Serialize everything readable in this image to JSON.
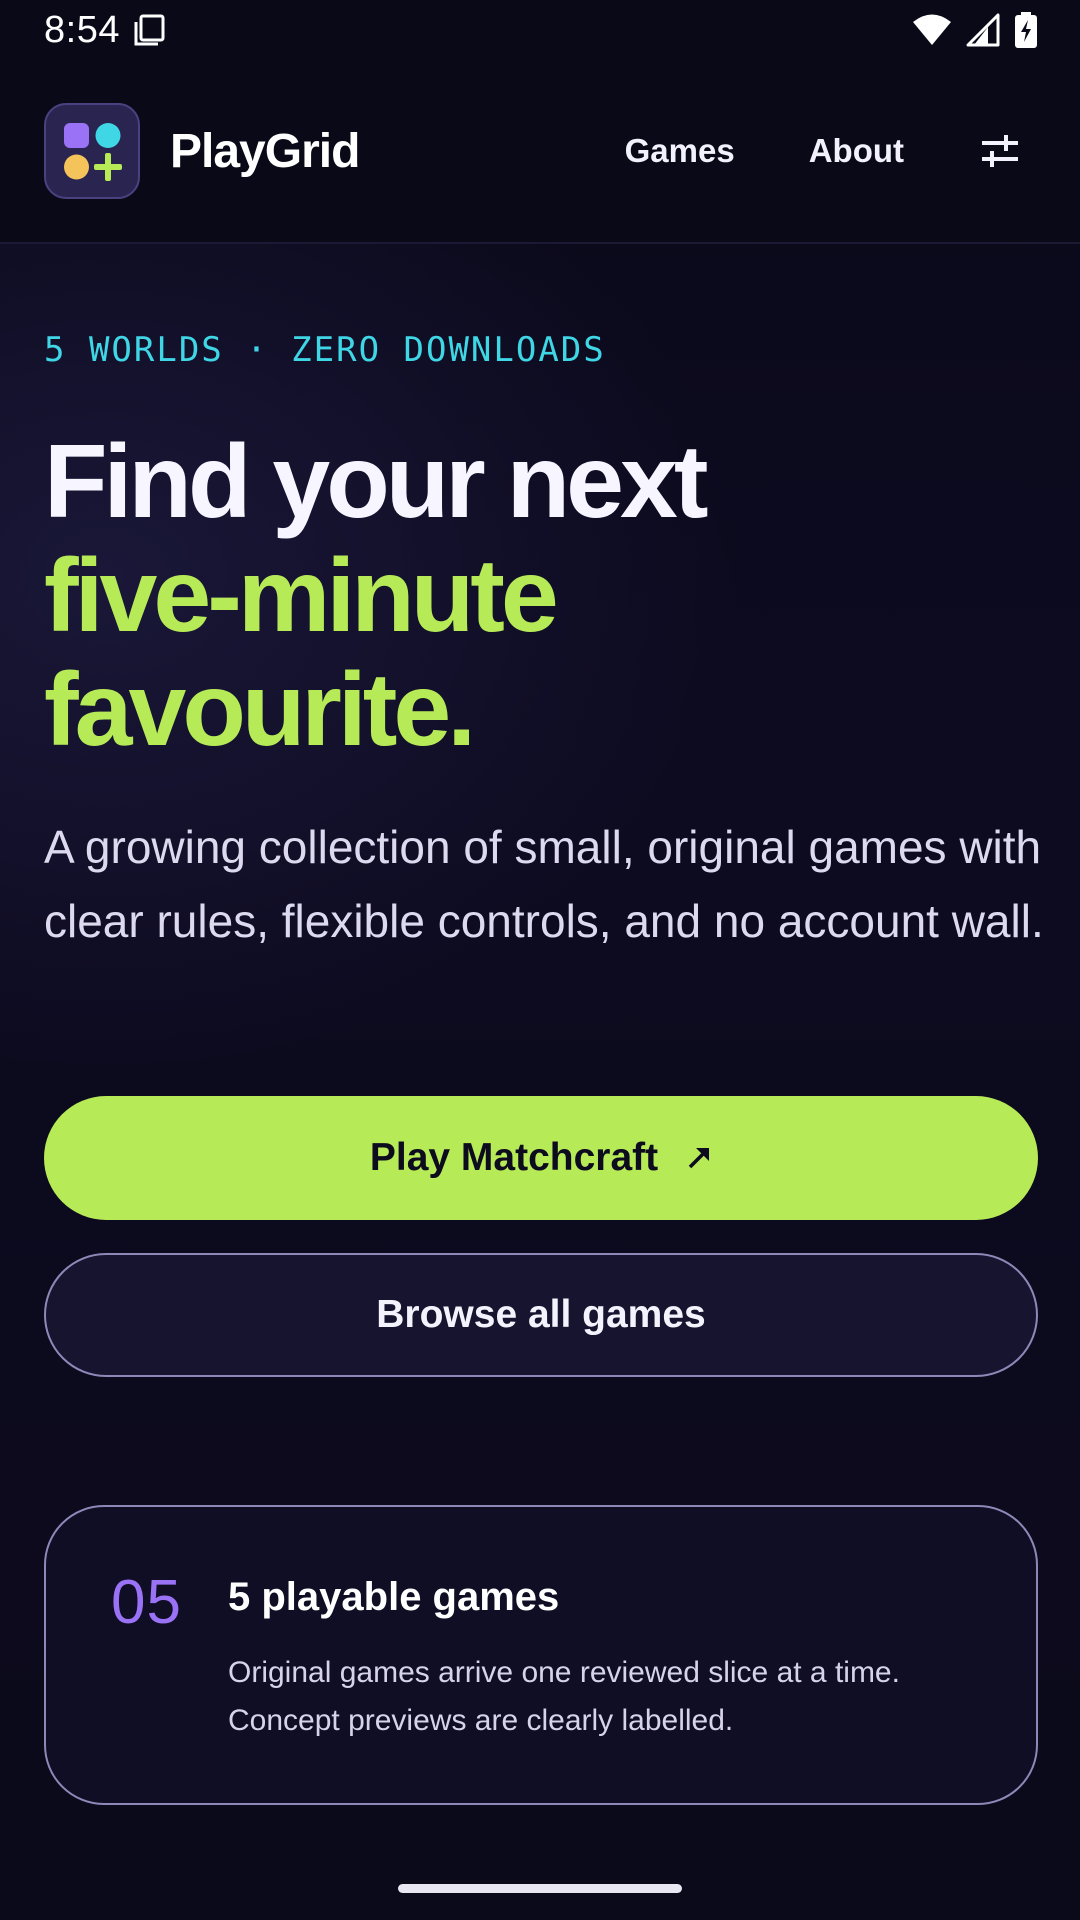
{
  "status_bar": {
    "time": "8:54",
    "icons": [
      "screenshot-icon",
      "wifi-icon",
      "cell-signal-icon",
      "battery-charging-icon"
    ]
  },
  "header": {
    "brand": "PlayGrid",
    "nav": [
      {
        "label": "Games"
      },
      {
        "label": "About"
      }
    ],
    "settings_icon": "sliders-icon"
  },
  "hero": {
    "eyebrow": "5 WORLDS · ZERO DOWNLOADS",
    "headline_line1": "Find your next",
    "headline_line2": "five-minute",
    "headline_line3": "favourite.",
    "lede": "A growing collection of small, original games with clear rules, flexible controls, and no account wall.",
    "primary_cta": "Play Matchcraft",
    "primary_cta_icon": "arrow-up-right-icon",
    "secondary_cta": "Browse all games"
  },
  "stats_card": {
    "number": "05",
    "title": "5 playable games",
    "description": "Original games arrive one reviewed slice at a time. Concept previews are clearly labelled."
  },
  "colors": {
    "accent_lime": "#b6ea57",
    "accent_cyan": "#3fd6e6",
    "accent_purple": "#9a72f5",
    "background": "#0b0a1a"
  }
}
